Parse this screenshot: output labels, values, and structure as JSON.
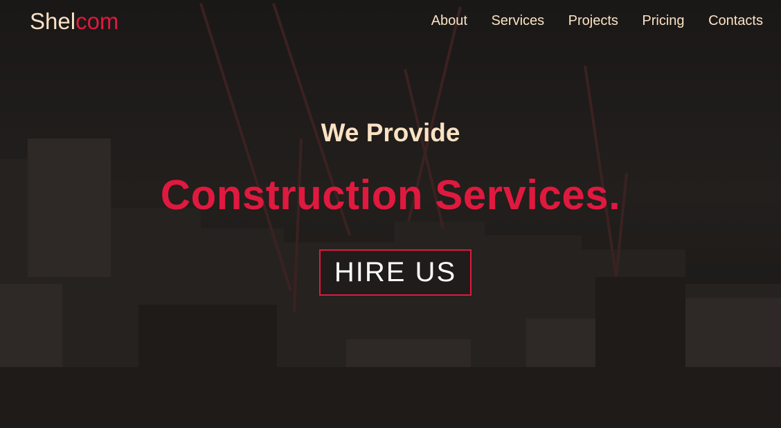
{
  "header": {
    "logo_part1": "Shel",
    "logo_part2": "com",
    "nav": [
      "About",
      "Services",
      "Projects",
      "Pricing",
      "Contacts"
    ]
  },
  "hero": {
    "subtitle": "We Provide",
    "title": "Construction Services.",
    "cta_label": "HIRE US"
  },
  "colors": {
    "accent": "#e0193f",
    "text_light": "#fbe2c4",
    "background": "#1b1918"
  }
}
